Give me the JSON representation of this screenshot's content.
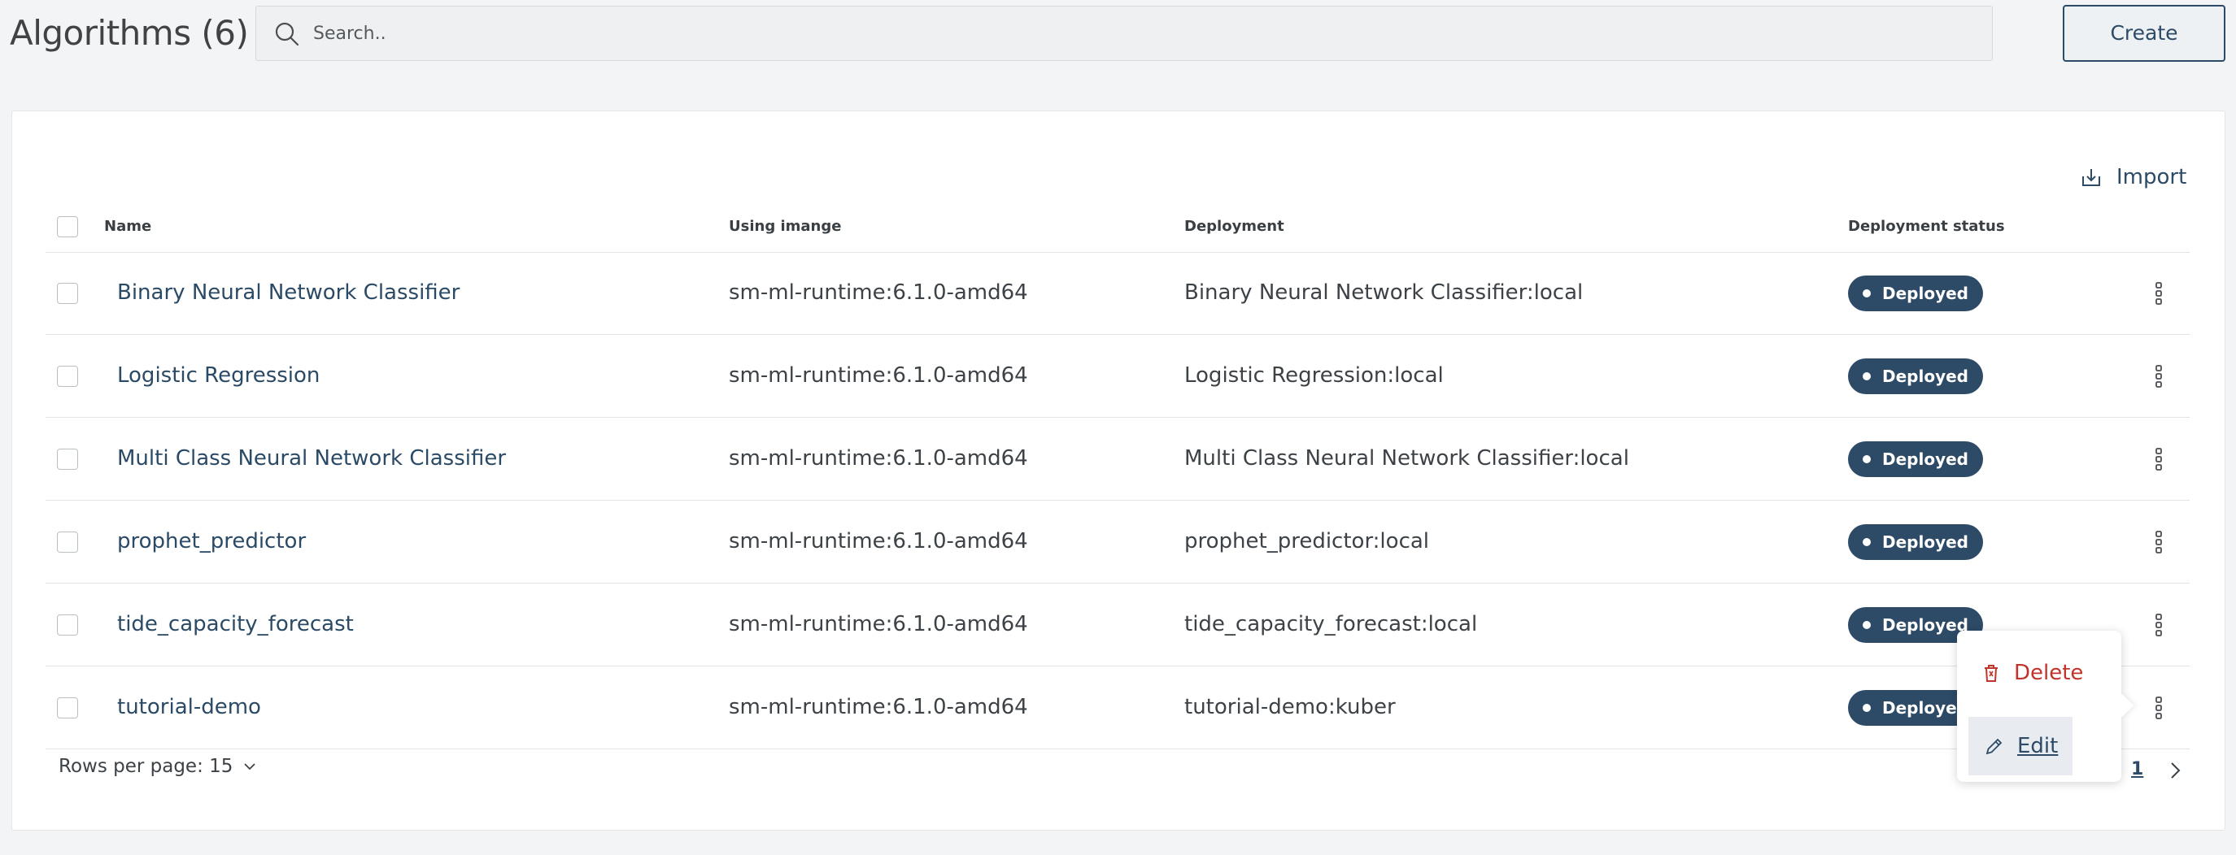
{
  "header": {
    "title": "Algorithms (6)",
    "search_placeholder": "Search..",
    "create_label": "Create"
  },
  "toolbar": {
    "import_label": "Import"
  },
  "table": {
    "columns": [
      "Name",
      "Using imange",
      "Deployment",
      "Deployment status"
    ],
    "rows": [
      {
        "name": "Binary Neural Network Classifier",
        "image": "sm-ml-runtime:6.1.0-amd64",
        "deployment": "Binary Neural Network Classifier:local",
        "status": "Deployed"
      },
      {
        "name": "Logistic Regression",
        "image": "sm-ml-runtime:6.1.0-amd64",
        "deployment": "Logistic Regression:local",
        "status": "Deployed"
      },
      {
        "name": "Multi Class Neural Network Classifier",
        "image": "sm-ml-runtime:6.1.0-amd64",
        "deployment": "Multi Class Neural Network Classifier:local",
        "status": "Deployed"
      },
      {
        "name": "prophet_predictor",
        "image": "sm-ml-runtime:6.1.0-amd64",
        "deployment": "prophet_predictor:local",
        "status": "Deployed"
      },
      {
        "name": "tide_capacity_forecast",
        "image": "sm-ml-runtime:6.1.0-amd64",
        "deployment": "tide_capacity_forecast:local",
        "status": "Deployed"
      },
      {
        "name": "tutorial-demo",
        "image": "sm-ml-runtime:6.1.0-amd64",
        "deployment": "tutorial-demo:kuber",
        "status": "Deployed"
      }
    ]
  },
  "pagination": {
    "rows_per_page": "Rows per page: 15",
    "current_page": "1"
  },
  "context_menu": {
    "delete_label": "Delete",
    "edit_label": "Edit"
  },
  "colors": {
    "primary": "#2d4a66",
    "danger": "#c0342b",
    "background": "#f3f4f5"
  }
}
